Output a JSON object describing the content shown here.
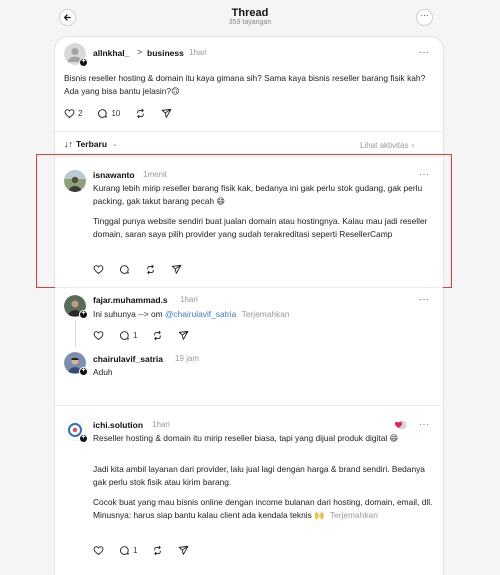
{
  "header": {
    "title": "Thread",
    "subtitle": "359 tayangan"
  },
  "main_post": {
    "username": "allnkhal_",
    "separator": ">",
    "topic": "business",
    "time": "1hari",
    "text": "Bisnis reseller hosting & domain itu kaya gimana sih? Sama kaya bisnis reseller barang fisik kah? Ada yang bisa bantu jelasin?🙃",
    "likes": "2",
    "replies": "10"
  },
  "sort": {
    "label": "Terbaru",
    "activity_link": "Lihat aktivitas"
  },
  "replies": [
    {
      "username": "isnawanto",
      "time": "1menit",
      "paragraphs": [
        "Kurang lebih mirip reseller barang fisik kak, bedanya ini gak perlu stok gudang, gak perlu packing, gak takut barang pecah 😄",
        "Tinggal punya website sendiri buat jualan domain atau hostingnya. Kalau mau jadi reseller domain, saran saya pilih provider yang sudah terakreditasi seperti ResellerCamp"
      ]
    },
    {
      "username": "fajar.muhammad.s",
      "time": "1hari",
      "text_prefix": "Ini suhunya --> om ",
      "mention": "@chairulavif_satria",
      "translate": "Terjemahkan",
      "replies": "1"
    },
    {
      "username": "chairulavif_satria",
      "time": "19 jam",
      "text": "Aduh"
    },
    {
      "username": "ichi.solution",
      "time": "1hari",
      "paragraphs": [
        "Reseller hosting & domain itu mirip reseller biasa, tapi yang dijual produk digital 😄",
        "Jadi kita ambil layanan dari provider, lalu jual lagi dengan harga & brand sendiri. Bedanya gak perlu stok fisik atau kirim barang.",
        "Cocok buat yang mau bisnis online dengan income bulanan dari hosting, domain, email, dll. Minusnya: harus siap bantu kalau client ada kendala teknis 🙌"
      ],
      "translate": "Terjemahkan",
      "replies": "1"
    }
  ],
  "colors": {
    "highlight": "#e23b3b",
    "link": "#3a7bd5",
    "heart_badge": "#e0245e"
  }
}
